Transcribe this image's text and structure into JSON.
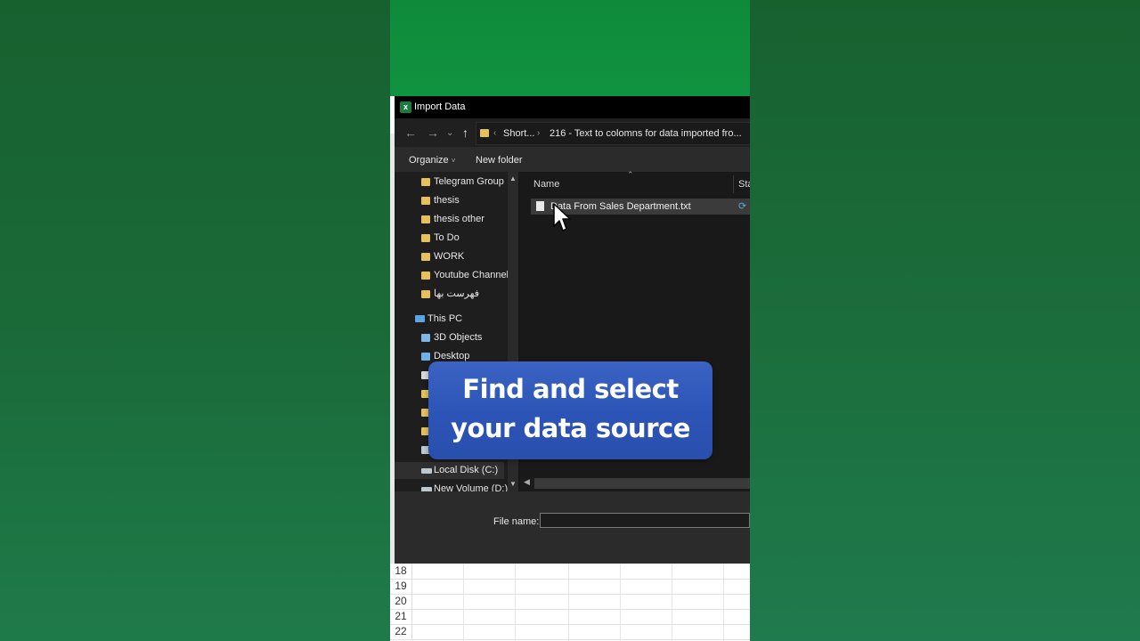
{
  "colors": {
    "side_background": "#1a6a38",
    "caption_background": "#2f58bb",
    "dialog_background": "#202020",
    "folder_icon": "#e6c15a"
  },
  "dialog": {
    "title": "Import Data",
    "app_icon": "excel-icon",
    "address": {
      "crumb_1": "Short...",
      "crumb_2": "216 - Text to colomns for data imported fro..."
    },
    "toolbar": {
      "organize_label": "Organize",
      "organize_caret": "˅",
      "new_folder_label": "New folder"
    },
    "nav_items": [
      {
        "label": "Telegram Group",
        "icon": "folder-icon"
      },
      {
        "label": "thesis",
        "icon": "folder-icon"
      },
      {
        "label": "thesis other",
        "icon": "folder-icon"
      },
      {
        "label": "To Do",
        "icon": "folder-icon"
      },
      {
        "label": "WORK",
        "icon": "folder-icon"
      },
      {
        "label": "Youtube Channel",
        "icon": "folder-icon"
      },
      {
        "label": "فهرست بها",
        "icon": "folder-icon"
      },
      {
        "label": "This PC",
        "icon": "pc-icon"
      },
      {
        "label": "3D Objects",
        "icon": "folder-icon"
      },
      {
        "label": "Desktop",
        "icon": "folder-icon"
      },
      {
        "label": "Local Disk (C:)",
        "icon": "disk-icon"
      },
      {
        "label": "New Volume (D:)",
        "icon": "disk-icon"
      }
    ],
    "columns": {
      "name": "Name",
      "status": "Sta"
    },
    "files": [
      {
        "name": "Data From Sales Department.txt",
        "icon": "text-file-icon"
      }
    ],
    "file_name_label": "File name:",
    "file_name_value": ""
  },
  "caption": {
    "line_1": "Find and select",
    "line_2": "your data source"
  },
  "sheet_rows": [
    "18",
    "19",
    "20",
    "21",
    "22"
  ]
}
